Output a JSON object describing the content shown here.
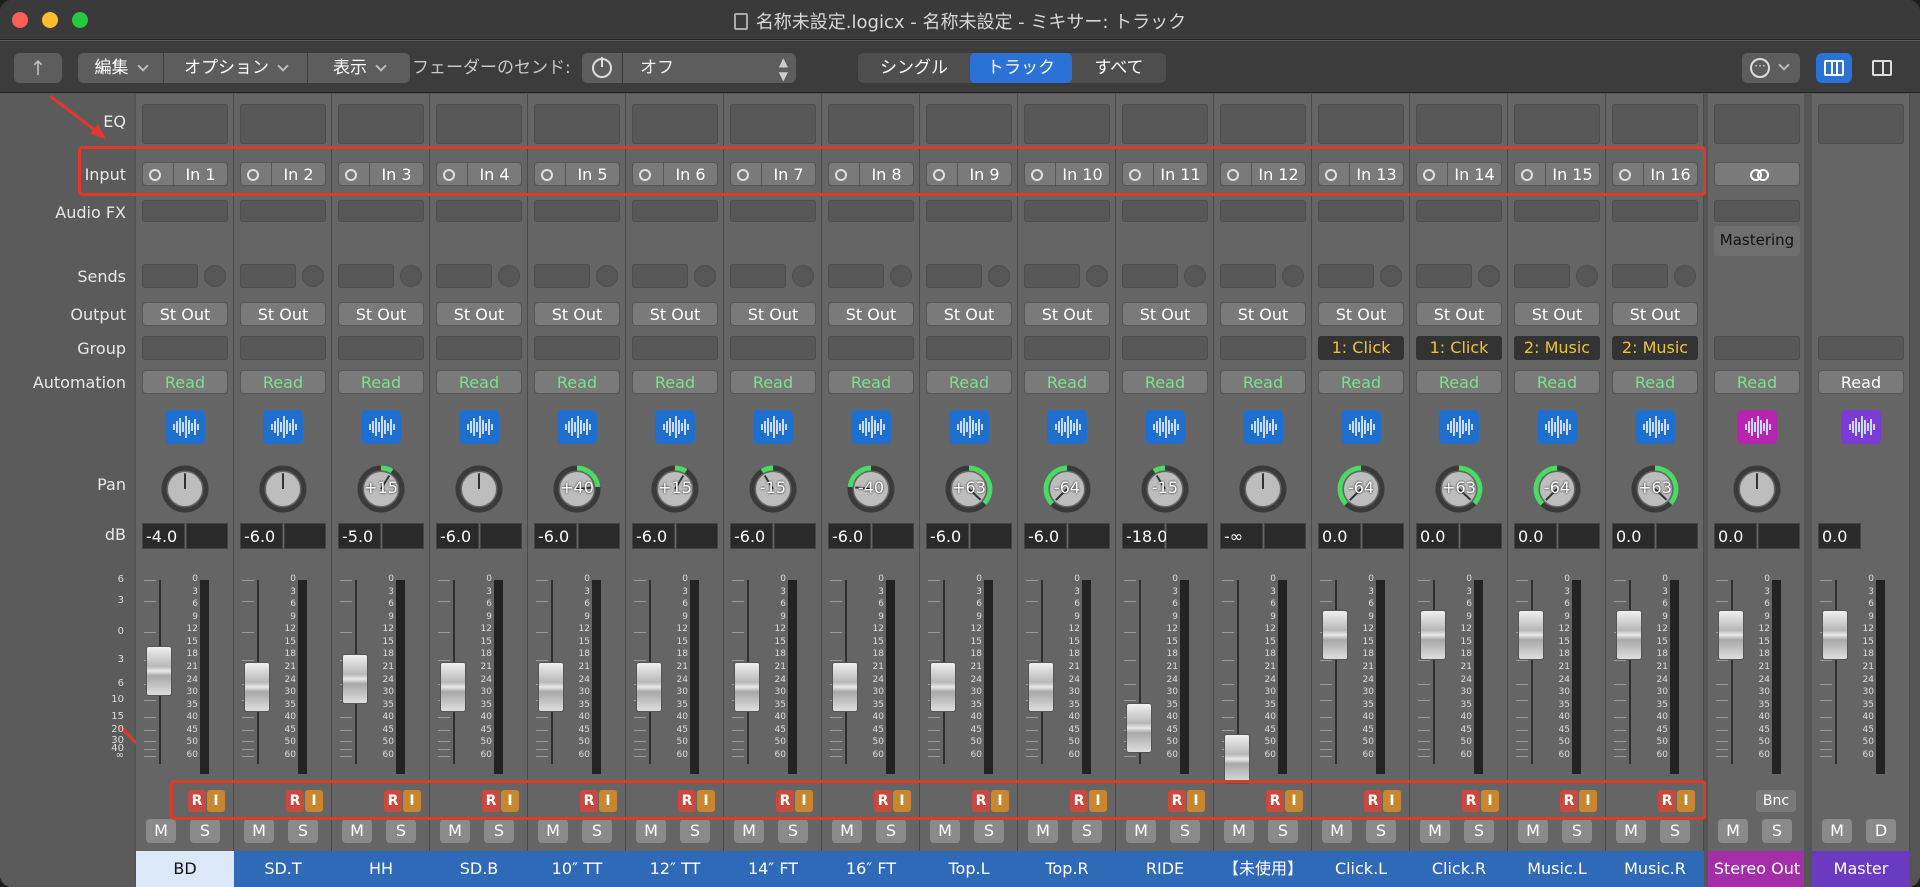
{
  "title": "名称未設定.logicx - 名称未設定 - ミキサー: トラック",
  "toolbar": {
    "edit": "編集",
    "options": "オプション",
    "view": "表示",
    "fader_send_label": "フェーダーのセンド:",
    "fader_send_value": "オフ",
    "single": "シングル",
    "tracks": "トラック",
    "all": "すべて"
  },
  "row_labels": {
    "eq": "EQ",
    "input": "Input",
    "audio_fx": "Audio FX",
    "sends": "Sends",
    "output": "Output",
    "group": "Group",
    "automation": "Automation",
    "pan": "Pan",
    "db": "dB"
  },
  "fader_scale": [
    "6",
    "3",
    "0",
    "3",
    "6",
    "10",
    "15",
    "20",
    "30",
    "40",
    "∞"
  ],
  "meter_scale": [
    "0",
    "3",
    "6",
    "9",
    "12",
    "15",
    "18",
    "21",
    "24",
    "30",
    "35",
    "40",
    "45",
    "50",
    "60"
  ],
  "channels": [
    {
      "name": "BD",
      "input": "In 1",
      "output": "St Out",
      "group": "",
      "automation": "Read",
      "pan": "",
      "pan_value": 0,
      "db": "-4.0",
      "fader_db": -4.0,
      "type": "audio",
      "mute": "M",
      "solo": "S"
    },
    {
      "name": "SD.T",
      "input": "In 2",
      "output": "St Out",
      "group": "",
      "automation": "Read",
      "pan": "",
      "pan_value": 0,
      "db": "-6.0",
      "fader_db": -6.0,
      "type": "audio",
      "mute": "M",
      "solo": "S"
    },
    {
      "name": "HH",
      "input": "In 3",
      "output": "St Out",
      "group": "",
      "automation": "Read",
      "pan": "+15",
      "pan_value": 15,
      "db": "-5.0",
      "fader_db": -5.0,
      "type": "audio",
      "mute": "M",
      "solo": "S"
    },
    {
      "name": "SD.B",
      "input": "In 4",
      "output": "St Out",
      "group": "",
      "automation": "Read",
      "pan": "",
      "pan_value": 0,
      "db": "-6.0",
      "fader_db": -6.0,
      "type": "audio",
      "mute": "M",
      "solo": "S"
    },
    {
      "name": "10″ TT",
      "input": "In 5",
      "output": "St Out",
      "group": "",
      "automation": "Read",
      "pan": "+40",
      "pan_value": 40,
      "db": "-6.0",
      "fader_db": -6.0,
      "type": "audio",
      "mute": "M",
      "solo": "S"
    },
    {
      "name": "12″ TT",
      "input": "In 6",
      "output": "St Out",
      "group": "",
      "automation": "Read",
      "pan": "+15",
      "pan_value": 15,
      "db": "-6.0",
      "fader_db": -6.0,
      "type": "audio",
      "mute": "M",
      "solo": "S"
    },
    {
      "name": "14″ FT",
      "input": "In 7",
      "output": "St Out",
      "group": "",
      "automation": "Read",
      "pan": "-15",
      "pan_value": -15,
      "db": "-6.0",
      "fader_db": -6.0,
      "type": "audio",
      "mute": "M",
      "solo": "S"
    },
    {
      "name": "16″ FT",
      "input": "In 8",
      "output": "St Out",
      "group": "",
      "automation": "Read",
      "pan": "-40",
      "pan_value": -40,
      "db": "-6.0",
      "fader_db": -6.0,
      "type": "audio",
      "mute": "M",
      "solo": "S"
    },
    {
      "name": "Top.L",
      "input": "In 9",
      "output": "St Out",
      "group": "",
      "automation": "Read",
      "pan": "+63",
      "pan_value": 63,
      "db": "-6.0",
      "fader_db": -6.0,
      "type": "audio",
      "mute": "M",
      "solo": "S"
    },
    {
      "name": "Top.R",
      "input": "In 10",
      "output": "St Out",
      "group": "",
      "automation": "Read",
      "pan": "-64",
      "pan_value": -64,
      "db": "-6.0",
      "fader_db": -6.0,
      "type": "audio",
      "mute": "M",
      "solo": "S"
    },
    {
      "name": "RIDE",
      "input": "In 11",
      "output": "St Out",
      "group": "",
      "automation": "Read",
      "pan": "-15",
      "pan_value": -15,
      "db": "-18.0",
      "fader_db": -18.0,
      "type": "audio",
      "mute": "M",
      "solo": "S"
    },
    {
      "name": "【未使用】",
      "input": "In 12",
      "output": "St Out",
      "group": "",
      "automation": "Read",
      "pan": "",
      "pan_value": 0,
      "db": "-∞",
      "fader_db": -100,
      "type": "audio",
      "mute": "M",
      "solo": "S"
    },
    {
      "name": "Click.L",
      "input": "In 13",
      "output": "St Out",
      "group": "1: Click",
      "automation": "Read",
      "pan": "-64",
      "pan_value": -64,
      "db": "0.0",
      "fader_db": 0.0,
      "type": "audio",
      "mute": "M",
      "solo": "S"
    },
    {
      "name": "Click.R",
      "input": "In 14",
      "output": "St Out",
      "group": "1: Click",
      "automation": "Read",
      "pan": "+63",
      "pan_value": 63,
      "db": "0.0",
      "fader_db": 0.0,
      "type": "audio",
      "mute": "M",
      "solo": "S"
    },
    {
      "name": "Music.L",
      "input": "In 15",
      "output": "St Out",
      "group": "2: Music",
      "automation": "Read",
      "pan": "-64",
      "pan_value": -64,
      "db": "0.0",
      "fader_db": 0.0,
      "type": "audio",
      "mute": "M",
      "solo": "S"
    },
    {
      "name": "Music.R",
      "input": "In 16",
      "output": "St Out",
      "group": "2: Music",
      "automation": "Read",
      "pan": "+63",
      "pan_value": 63,
      "db": "0.0",
      "fader_db": 0.0,
      "type": "audio",
      "mute": "M",
      "solo": "S"
    },
    {
      "name": "Stereo Out",
      "input": "",
      "output": "",
      "group": "",
      "automation": "Read",
      "audio_fx": "Mastering",
      "pan": "",
      "pan_value": 0,
      "db": "0.0",
      "fader_db": 0.0,
      "type": "stereo",
      "mute": "M",
      "solo": "S",
      "bnc": "Bnc"
    },
    {
      "name": "Master",
      "input": "",
      "output": "",
      "group": "",
      "automation": "Read",
      "pan": "",
      "pan_value": 0,
      "db": "0.0",
      "fader_db": 0.0,
      "type": "master",
      "mute": "M",
      "solo": "D"
    }
  ],
  "colors": {
    "audio_icon": "#1e6fd0",
    "stereo_icon": "#b624b0",
    "master_icon": "#7a3bd6",
    "name_bar": "#2e6ab8",
    "selected_name": "#dbe8f8",
    "stereo_name": "#a42ea8",
    "master_name": "#6a3ac0",
    "read": "#7ee08a",
    "group_text": "#f0c23c",
    "highlight": "#e0382b",
    "pan_ring": "#4cd964"
  }
}
